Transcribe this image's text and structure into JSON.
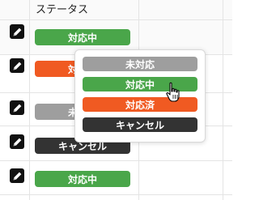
{
  "table": {
    "header_status": "ステータス",
    "rows": [
      {
        "status": "対応中",
        "color": "#4aa64a"
      },
      {
        "status": "対応済",
        "color": "#f05a22"
      },
      {
        "status": "未対応",
        "color": "#9e9e9e"
      },
      {
        "status": "キャンセル",
        "color": "#333333"
      },
      {
        "status": "対応中",
        "color": "#4aa64a"
      }
    ]
  },
  "dropdown": {
    "options": [
      {
        "label": "未対応",
        "color": "#9e9e9e"
      },
      {
        "label": "対応中",
        "color": "#4aa64a"
      },
      {
        "label": "対応済",
        "color": "#f05a22"
      },
      {
        "label": "キャンセル",
        "color": "#333333"
      }
    ]
  },
  "icons": {
    "edit": "pencil-icon",
    "cursor": "hand-pointer-icon"
  }
}
